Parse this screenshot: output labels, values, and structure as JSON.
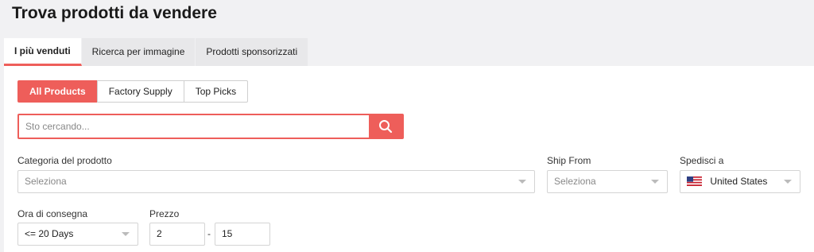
{
  "page": {
    "title": "Trova prodotti da vendere"
  },
  "tabs": [
    {
      "label": "I più venduti",
      "active": true
    },
    {
      "label": "Ricerca per immagine",
      "active": false
    },
    {
      "label": "Prodotti sponsorizzati",
      "active": false
    }
  ],
  "segments": [
    {
      "label": "All Products",
      "active": true
    },
    {
      "label": "Factory Supply",
      "active": false
    },
    {
      "label": "Top Picks",
      "active": false
    }
  ],
  "search": {
    "placeholder": "Sto cercando...",
    "value": "",
    "icon": "search-icon"
  },
  "filters": {
    "category": {
      "label": "Categoria del prodotto",
      "value": "Seleziona"
    },
    "ship_from": {
      "label": "Ship From",
      "value": "Seleziona"
    },
    "ship_to": {
      "label": "Spedisci a",
      "value": "United States",
      "icon": "us-flag-icon"
    },
    "delivery": {
      "label": "Ora di consegna",
      "value": "<= 20 Days"
    },
    "price": {
      "label": "Prezzo",
      "min": "2",
      "separator": "-",
      "max": "15"
    }
  },
  "colors": {
    "accent": "#ee5e5a",
    "background": "#f1f1f3",
    "panel": "#ffffff"
  }
}
